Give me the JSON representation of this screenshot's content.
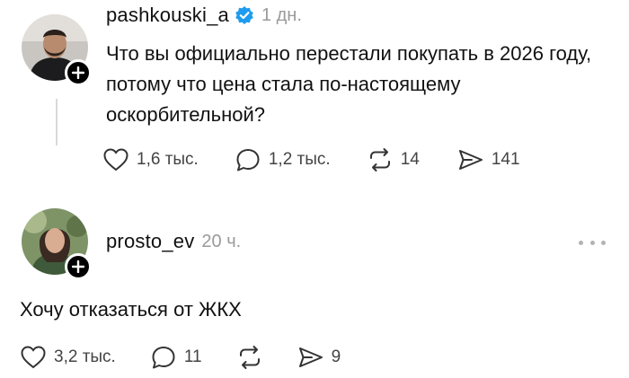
{
  "post": {
    "username": "pashkouski_a",
    "time": "1 дн.",
    "text": "Что вы официально перестали покупать в 2026 году, потому что цена стала по-настоящему оскорбительной?",
    "actions": {
      "likes": "1,6 тыс.",
      "replies": "1,2 тыс.",
      "reposts": "14",
      "shares": "141"
    }
  },
  "reply": {
    "username": "prosto_ev",
    "time": "20 ч.",
    "text": "Хочу отказаться от ЖКХ",
    "actions": {
      "likes": "3,2 тыс.",
      "replies": "11",
      "reposts": "",
      "shares": "9"
    }
  },
  "colors": {
    "text": "#111111",
    "muted": "#9a9a9a",
    "verified": "#1d9bf0",
    "icon": "#333333"
  },
  "icons": [
    "heart-icon",
    "comment-icon",
    "repost-icon",
    "share-icon",
    "verified-icon",
    "plus-icon",
    "more-icon"
  ]
}
